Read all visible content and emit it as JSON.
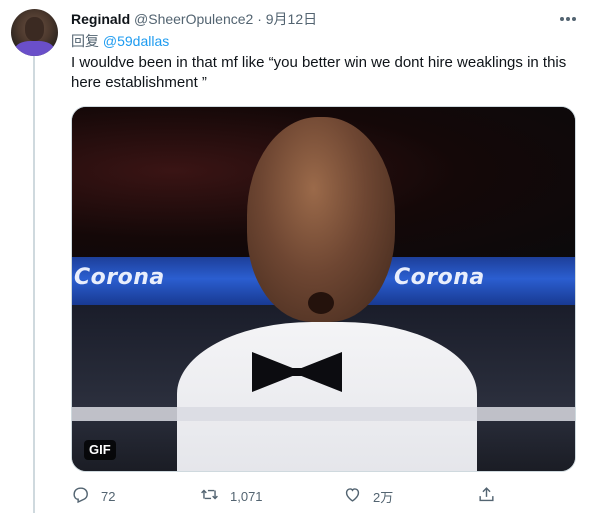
{
  "tweet": {
    "author_name": "Reginald",
    "author_handle": "@SheerOpulence2",
    "separator": "·",
    "date": "9月12日",
    "reply_prefix": "回复",
    "reply_to": "@59dallas",
    "text": "I wouldve been in that mf like “you better win we dont hire weaklings in this here establishment ”",
    "media": {
      "badge": "GIF",
      "banner_left": "Corona",
      "banner_right": "Corona"
    },
    "actions": {
      "reply_count": "72",
      "retweet_count": "1,071",
      "like_count": "2万",
      "reply_icon": "reply-icon",
      "retweet_icon": "retweet-icon",
      "like_icon": "heart-icon",
      "share_icon": "share-icon"
    }
  },
  "colors": {
    "link": "#1d9bf0",
    "secondary_text": "#536471",
    "thread_line": "#cfd9de"
  }
}
